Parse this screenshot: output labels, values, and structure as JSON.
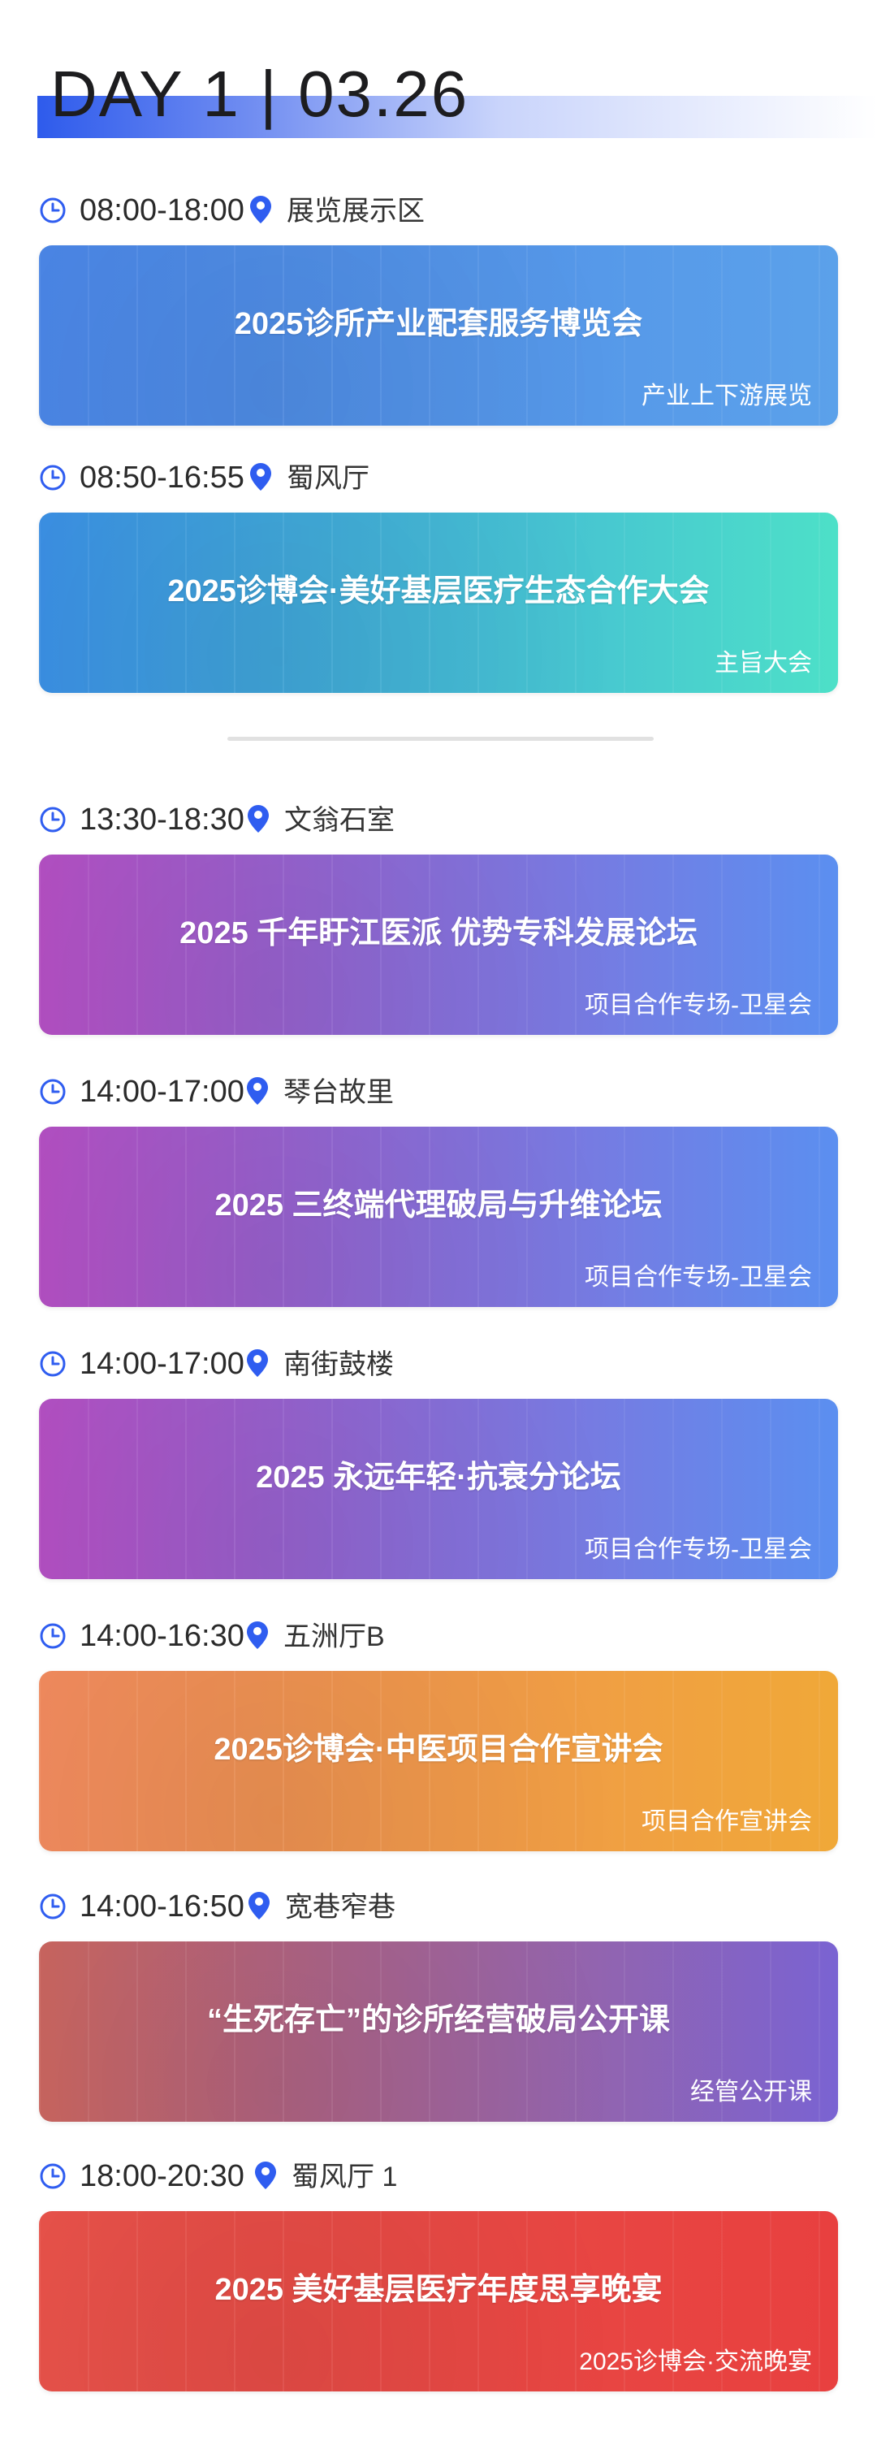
{
  "header": {
    "title": "DAY 1 | 03.26"
  },
  "events": [
    {
      "time": "08:00-18:00",
      "place": "展览展示区",
      "title": "2025诊所产业配套服务博览会",
      "subtitle": "产业上下游展览"
    },
    {
      "time": "08:50-16:55",
      "place": "蜀风厅",
      "title": "2025诊博会·美好基层医疗生态合作大会",
      "subtitle": "主旨大会"
    },
    {
      "time": "13:30-18:30",
      "place": "文翁石室",
      "title": "2025 千年盱江医派 优势专科发展论坛",
      "subtitle": "项目合作专场-卫星会"
    },
    {
      "time": "14:00-17:00",
      "place": "琴台故里",
      "title": "2025 三终端代理破局与升维论坛",
      "subtitle": "项目合作专场-卫星会"
    },
    {
      "time": "14:00-17:00",
      "place": "南街鼓楼",
      "title": "2025 永远年轻·抗衰分论坛",
      "subtitle": "项目合作专场-卫星会"
    },
    {
      "time": "14:00-16:30",
      "place": "五洲厅B",
      "title": "2025诊博会·中医项目合作宣讲会",
      "subtitle": "项目合作宣讲会"
    },
    {
      "time": "14:00-16:50",
      "place": "宽巷窄巷",
      "title": "“生死存亡”的诊所经营破局公开课",
      "subtitle": "经管公开课"
    },
    {
      "time": "18:00-20:30",
      "place": "蜀风厅 1",
      "title": "2025 美好基层医疗年度思享晚宴",
      "subtitle": "2025诊博会·交流晚宴"
    }
  ],
  "colors": {
    "accent": "#2f5df0",
    "card_gradients": [
      [
        "#4b86e6",
        "#5ba1ea"
      ],
      [
        "#3b8fe3",
        "#4de0c8"
      ],
      [
        "#b34fc2",
        "#5b8ff0"
      ],
      [
        "#b34fc2",
        "#5b8ff0"
      ],
      [
        "#b34fc2",
        "#5b8ff0"
      ],
      [
        "#f08a5e",
        "#f0a838"
      ],
      [
        "#c9655f",
        "#7a63d2"
      ],
      [
        "#e8524a",
        "#e8403f"
      ]
    ]
  },
  "icons": {
    "time": "clock-icon",
    "location": "location-pin-icon"
  }
}
